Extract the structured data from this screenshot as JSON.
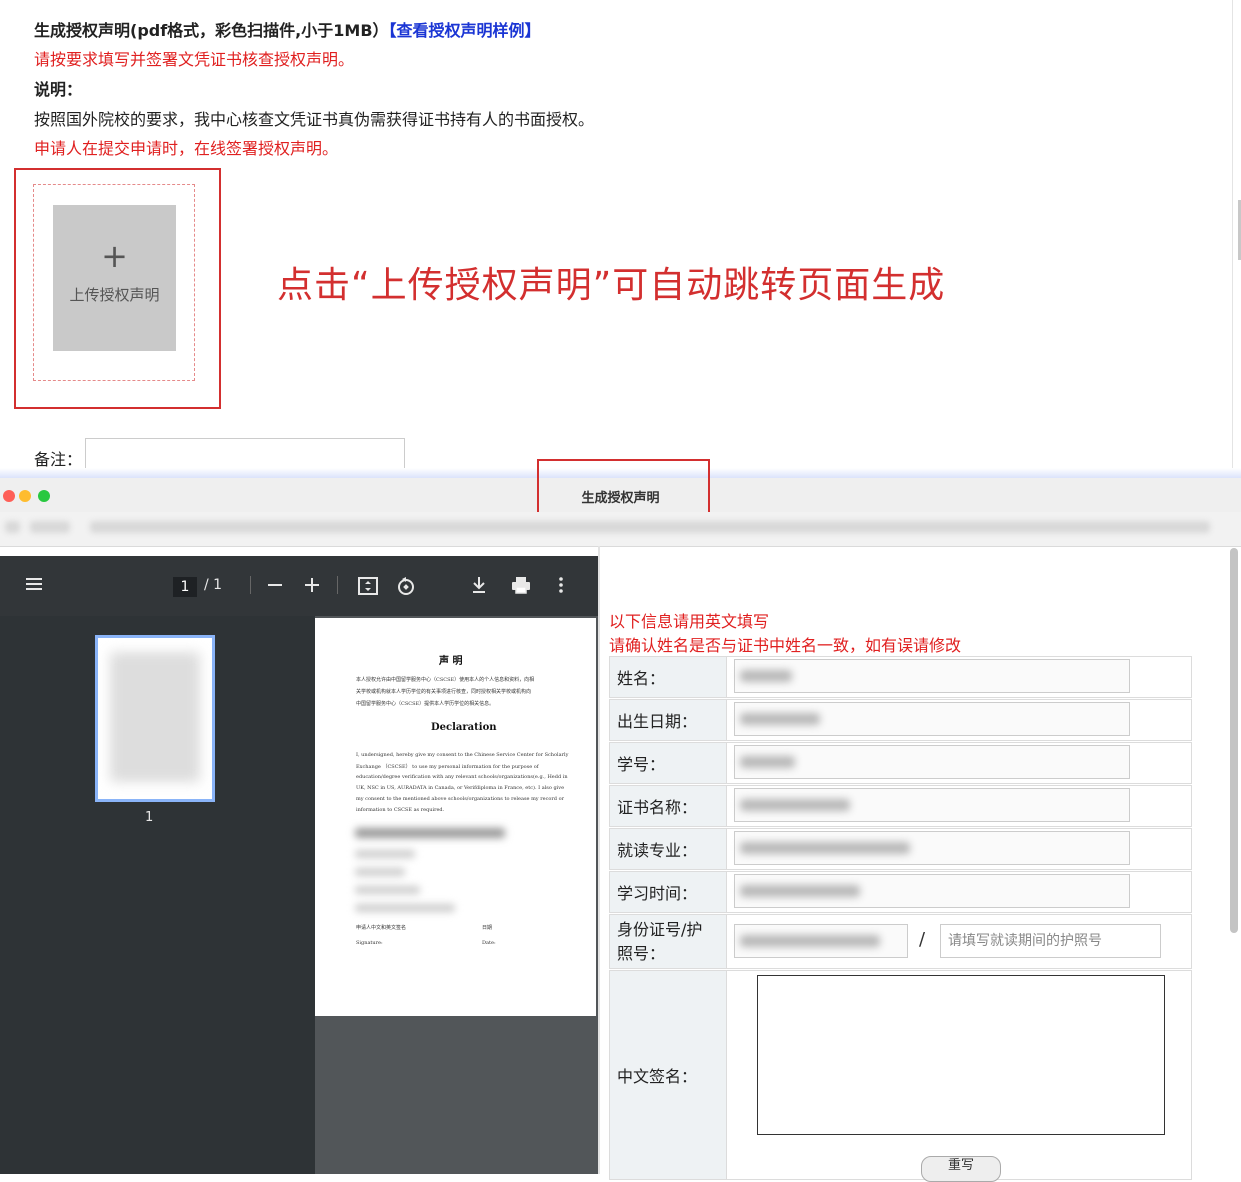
{
  "top": {
    "heading": "生成授权声明(pdf格式，彩色扫描件,小于1MB）",
    "sample_link": "【查看授权声明样例】",
    "instruction_red": "请按要求填写并签署文凭证书核查授权声明。",
    "note_label": "说明：",
    "note_text": "按照国外院校的要求，我中心核查文凭证书真伪需获得证书持有人的书面授权。",
    "note_red": "申请人在提交申请时，在线签署授权声明。",
    "upload_plus": "+",
    "upload_label": "上传授权声明",
    "annotation": "点击“上传授权声明”可自动跳转页面生成",
    "remark_label": "备注："
  },
  "window": {
    "title": "生成授权声明"
  },
  "pdf_viewer": {
    "page_current": "1",
    "page_total": "/ 1",
    "thumb_number": "1",
    "icons": [
      "menu-icon",
      "zoom-out-icon",
      "zoom-in-icon",
      "fit-page-icon",
      "rotate-icon",
      "download-icon",
      "print-icon",
      "more-icon"
    ],
    "page": {
      "cn_title": "声 明",
      "en_title": "Declaration",
      "cn_para": [
        "本人授权允许由中国留学服务中心（CSCSE）使用本人的个人信息和资料，向相",
        "关学校或机构就本人学历学位的有关事项进行核查，同时授权相关学校或机构向",
        "中国留学服务中心（CSCSE）提供本人学历学位的相关信息。"
      ],
      "en_para": [
        "I, undersigned, hereby give my consent to the Chinese Service Center for Scholarly",
        "Exchange （CSCSE） to use my personal information for the purpose of",
        "education/degree verification with any relevant schools/organizations(e.g., Hedd in",
        "UK, NSC in US, AURADATA in Canada, or Verifdiploma in France, etc). I also give",
        "my consent to the mentioned above schools/organizations to release my record or",
        "information to CSCSE as required."
      ],
      "sig_cn": "申请人中文和英文签名",
      "date_cn": "日期",
      "sig_en": "Signature:",
      "date_en": "Date:"
    }
  },
  "form": {
    "note1": "以下信息请用英文填写",
    "note2": "请确认姓名是否与证书中姓名一致，如有误请修改",
    "rows": [
      {
        "label": "姓名："
      },
      {
        "label": "出生日期："
      },
      {
        "label": "学号："
      },
      {
        "label": "证书名称："
      },
      {
        "label": "就读专业："
      },
      {
        "label": "学习时间："
      }
    ],
    "id_label_line1": "身份证号/护",
    "id_label_line2": "照号：",
    "slash": "/",
    "passport_placeholder": "请填写就读期间的护照号",
    "signature_label": "中文签名：",
    "rewrite_button": "重写"
  },
  "colors": {
    "annotation_red": "#d32f2f",
    "text_red": "#e02020",
    "link_blue": "#1a35d4",
    "pdf_toolbar": "#323639",
    "label_bg": "#eef2f4"
  }
}
